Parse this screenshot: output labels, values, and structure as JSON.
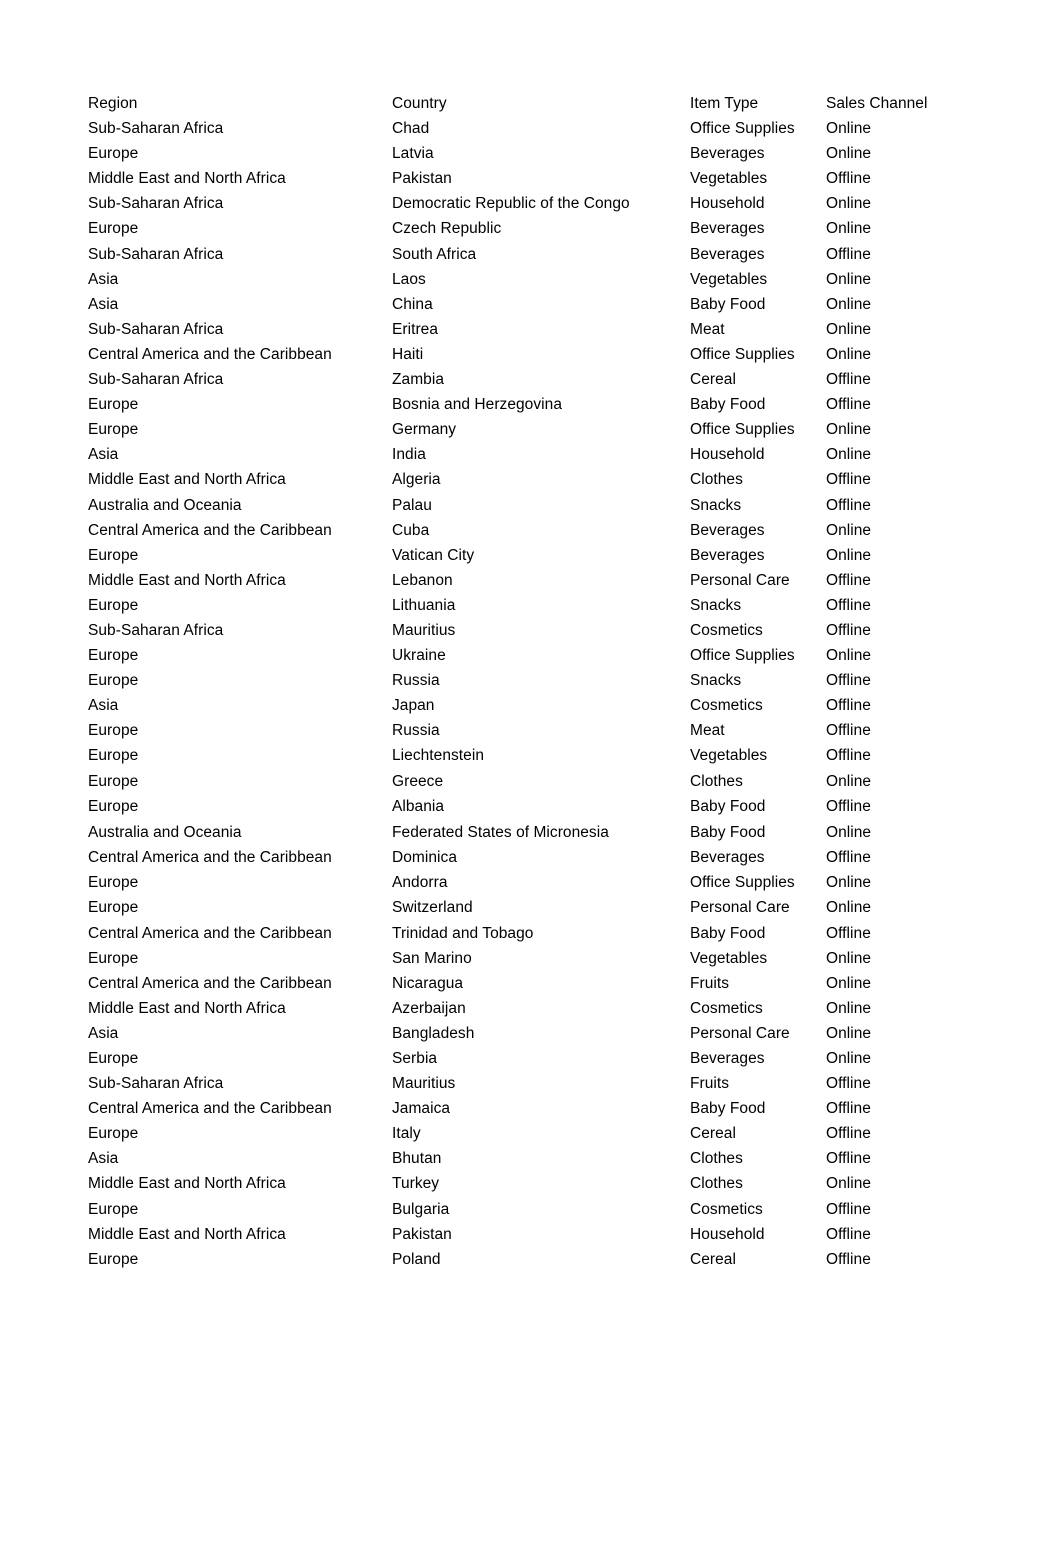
{
  "document": {
    "type": "spreadsheet-table",
    "background_color": "#ffffff",
    "text_color": "#000000"
  },
  "table": {
    "headers": [
      "Region",
      "Country",
      "Item Type",
      "Sales Channel"
    ],
    "rows": [
      [
        "Sub-Saharan Africa",
        "Chad",
        "Office Supplies",
        "Online"
      ],
      [
        "Europe",
        "Latvia",
        "Beverages",
        "Online"
      ],
      [
        "Middle East and North Africa",
        "Pakistan",
        "Vegetables",
        "Offline"
      ],
      [
        "Sub-Saharan Africa",
        "Democratic Republic of the Congo",
        "Household",
        "Online"
      ],
      [
        "Europe",
        "Czech Republic",
        "Beverages",
        "Online"
      ],
      [
        "Sub-Saharan Africa",
        "South Africa",
        "Beverages",
        "Offline"
      ],
      [
        "Asia",
        "Laos",
        "Vegetables",
        "Online"
      ],
      [
        "Asia",
        "China",
        "Baby Food",
        "Online"
      ],
      [
        "Sub-Saharan Africa",
        "Eritrea",
        "Meat",
        "Online"
      ],
      [
        "Central America and the Caribbean",
        "Haiti",
        "Office Supplies",
        "Online"
      ],
      [
        "Sub-Saharan Africa",
        "Zambia",
        "Cereal",
        "Offline"
      ],
      [
        "Europe",
        "Bosnia and Herzegovina",
        "Baby Food",
        "Offline"
      ],
      [
        "Europe",
        "Germany",
        "Office Supplies",
        "Online"
      ],
      [
        "Asia",
        "India",
        "Household",
        "Online"
      ],
      [
        "Middle East and North Africa",
        "Algeria",
        "Clothes",
        "Offline"
      ],
      [
        "Australia and Oceania",
        "Palau",
        "Snacks",
        "Offline"
      ],
      [
        "Central America and the Caribbean",
        "Cuba",
        "Beverages",
        "Online"
      ],
      [
        "Europe",
        "Vatican City",
        "Beverages",
        "Online"
      ],
      [
        "Middle East and North Africa",
        "Lebanon",
        "Personal Care",
        "Offline"
      ],
      [
        "Europe",
        "Lithuania",
        "Snacks",
        "Offline"
      ],
      [
        "Sub-Saharan Africa",
        "Mauritius",
        "Cosmetics",
        "Offline"
      ],
      [
        "Europe",
        "Ukraine",
        "Office Supplies",
        "Online"
      ],
      [
        "Europe",
        "Russia",
        "Snacks",
        "Offline"
      ],
      [
        "Asia",
        "Japan",
        "Cosmetics",
        "Offline"
      ],
      [
        "Europe",
        "Russia",
        "Meat",
        "Offline"
      ],
      [
        "Europe",
        "Liechtenstein",
        "Vegetables",
        "Offline"
      ],
      [
        "Europe",
        "Greece",
        "Clothes",
        "Online"
      ],
      [
        "Europe",
        "Albania",
        "Baby Food",
        "Offline"
      ],
      [
        "Australia and Oceania",
        "Federated States of Micronesia",
        "Baby Food",
        "Online"
      ],
      [
        "Central America and the Caribbean",
        "Dominica",
        "Beverages",
        "Offline"
      ],
      [
        "Europe",
        "Andorra",
        "Office Supplies",
        "Online"
      ],
      [
        "Europe",
        "Switzerland",
        "Personal Care",
        "Online"
      ],
      [
        "Central America and the Caribbean",
        "Trinidad and Tobago",
        "Baby Food",
        "Offline"
      ],
      [
        "Europe",
        "San Marino",
        "Vegetables",
        "Online"
      ],
      [
        "Central America and the Caribbean",
        "Nicaragua",
        "Fruits",
        "Online"
      ],
      [
        "Middle East and North Africa",
        "Azerbaijan",
        "Cosmetics",
        "Online"
      ],
      [
        "Asia",
        "Bangladesh",
        "Personal Care",
        "Online"
      ],
      [
        "Europe",
        "Serbia",
        "Beverages",
        "Online"
      ],
      [
        "Sub-Saharan Africa",
        "Mauritius",
        "Fruits",
        "Offline"
      ],
      [
        "Central America and the Caribbean",
        "Jamaica",
        "Baby Food",
        "Offline"
      ],
      [
        "Europe",
        "Italy",
        "Cereal",
        "Offline"
      ],
      [
        "Asia",
        "Bhutan",
        "Clothes",
        "Offline"
      ],
      [
        "Middle East and North Africa",
        "Turkey",
        "Clothes",
        "Online"
      ],
      [
        "Europe",
        "Bulgaria",
        "Cosmetics",
        "Offline"
      ],
      [
        "Middle East and North Africa",
        "Pakistan",
        "Household",
        "Offline"
      ],
      [
        "Europe",
        "Poland",
        "Cereal",
        "Offline"
      ]
    ],
    "row_gap_after_index": 26
  }
}
